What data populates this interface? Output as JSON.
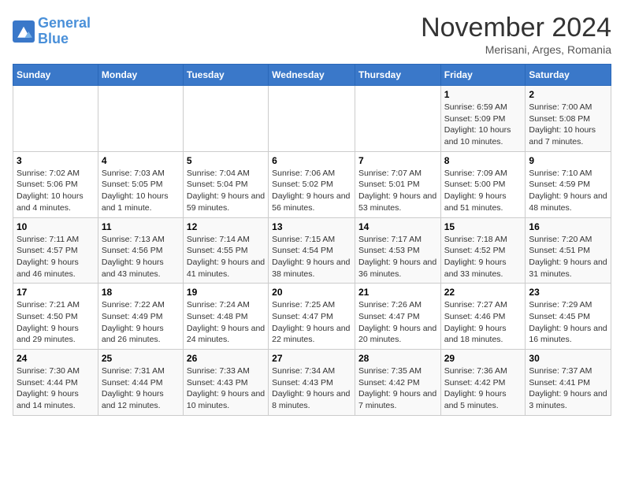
{
  "header": {
    "logo_line1": "General",
    "logo_line2": "Blue",
    "month_title": "November 2024",
    "subtitle": "Merisani, Arges, Romania"
  },
  "weekdays": [
    "Sunday",
    "Monday",
    "Tuesday",
    "Wednesday",
    "Thursday",
    "Friday",
    "Saturday"
  ],
  "weeks": [
    [
      {
        "day": "",
        "info": ""
      },
      {
        "day": "",
        "info": ""
      },
      {
        "day": "",
        "info": ""
      },
      {
        "day": "",
        "info": ""
      },
      {
        "day": "",
        "info": ""
      },
      {
        "day": "1",
        "info": "Sunrise: 6:59 AM\nSunset: 5:09 PM\nDaylight: 10 hours and 10 minutes."
      },
      {
        "day": "2",
        "info": "Sunrise: 7:00 AM\nSunset: 5:08 PM\nDaylight: 10 hours and 7 minutes."
      }
    ],
    [
      {
        "day": "3",
        "info": "Sunrise: 7:02 AM\nSunset: 5:06 PM\nDaylight: 10 hours and 4 minutes."
      },
      {
        "day": "4",
        "info": "Sunrise: 7:03 AM\nSunset: 5:05 PM\nDaylight: 10 hours and 1 minute."
      },
      {
        "day": "5",
        "info": "Sunrise: 7:04 AM\nSunset: 5:04 PM\nDaylight: 9 hours and 59 minutes."
      },
      {
        "day": "6",
        "info": "Sunrise: 7:06 AM\nSunset: 5:02 PM\nDaylight: 9 hours and 56 minutes."
      },
      {
        "day": "7",
        "info": "Sunrise: 7:07 AM\nSunset: 5:01 PM\nDaylight: 9 hours and 53 minutes."
      },
      {
        "day": "8",
        "info": "Sunrise: 7:09 AM\nSunset: 5:00 PM\nDaylight: 9 hours and 51 minutes."
      },
      {
        "day": "9",
        "info": "Sunrise: 7:10 AM\nSunset: 4:59 PM\nDaylight: 9 hours and 48 minutes."
      }
    ],
    [
      {
        "day": "10",
        "info": "Sunrise: 7:11 AM\nSunset: 4:57 PM\nDaylight: 9 hours and 46 minutes."
      },
      {
        "day": "11",
        "info": "Sunrise: 7:13 AM\nSunset: 4:56 PM\nDaylight: 9 hours and 43 minutes."
      },
      {
        "day": "12",
        "info": "Sunrise: 7:14 AM\nSunset: 4:55 PM\nDaylight: 9 hours and 41 minutes."
      },
      {
        "day": "13",
        "info": "Sunrise: 7:15 AM\nSunset: 4:54 PM\nDaylight: 9 hours and 38 minutes."
      },
      {
        "day": "14",
        "info": "Sunrise: 7:17 AM\nSunset: 4:53 PM\nDaylight: 9 hours and 36 minutes."
      },
      {
        "day": "15",
        "info": "Sunrise: 7:18 AM\nSunset: 4:52 PM\nDaylight: 9 hours and 33 minutes."
      },
      {
        "day": "16",
        "info": "Sunrise: 7:20 AM\nSunset: 4:51 PM\nDaylight: 9 hours and 31 minutes."
      }
    ],
    [
      {
        "day": "17",
        "info": "Sunrise: 7:21 AM\nSunset: 4:50 PM\nDaylight: 9 hours and 29 minutes."
      },
      {
        "day": "18",
        "info": "Sunrise: 7:22 AM\nSunset: 4:49 PM\nDaylight: 9 hours and 26 minutes."
      },
      {
        "day": "19",
        "info": "Sunrise: 7:24 AM\nSunset: 4:48 PM\nDaylight: 9 hours and 24 minutes."
      },
      {
        "day": "20",
        "info": "Sunrise: 7:25 AM\nSunset: 4:47 PM\nDaylight: 9 hours and 22 minutes."
      },
      {
        "day": "21",
        "info": "Sunrise: 7:26 AM\nSunset: 4:47 PM\nDaylight: 9 hours and 20 minutes."
      },
      {
        "day": "22",
        "info": "Sunrise: 7:27 AM\nSunset: 4:46 PM\nDaylight: 9 hours and 18 minutes."
      },
      {
        "day": "23",
        "info": "Sunrise: 7:29 AM\nSunset: 4:45 PM\nDaylight: 9 hours and 16 minutes."
      }
    ],
    [
      {
        "day": "24",
        "info": "Sunrise: 7:30 AM\nSunset: 4:44 PM\nDaylight: 9 hours and 14 minutes."
      },
      {
        "day": "25",
        "info": "Sunrise: 7:31 AM\nSunset: 4:44 PM\nDaylight: 9 hours and 12 minutes."
      },
      {
        "day": "26",
        "info": "Sunrise: 7:33 AM\nSunset: 4:43 PM\nDaylight: 9 hours and 10 minutes."
      },
      {
        "day": "27",
        "info": "Sunrise: 7:34 AM\nSunset: 4:43 PM\nDaylight: 9 hours and 8 minutes."
      },
      {
        "day": "28",
        "info": "Sunrise: 7:35 AM\nSunset: 4:42 PM\nDaylight: 9 hours and 7 minutes."
      },
      {
        "day": "29",
        "info": "Sunrise: 7:36 AM\nSunset: 4:42 PM\nDaylight: 9 hours and 5 minutes."
      },
      {
        "day": "30",
        "info": "Sunrise: 7:37 AM\nSunset: 4:41 PM\nDaylight: 9 hours and 3 minutes."
      }
    ]
  ]
}
